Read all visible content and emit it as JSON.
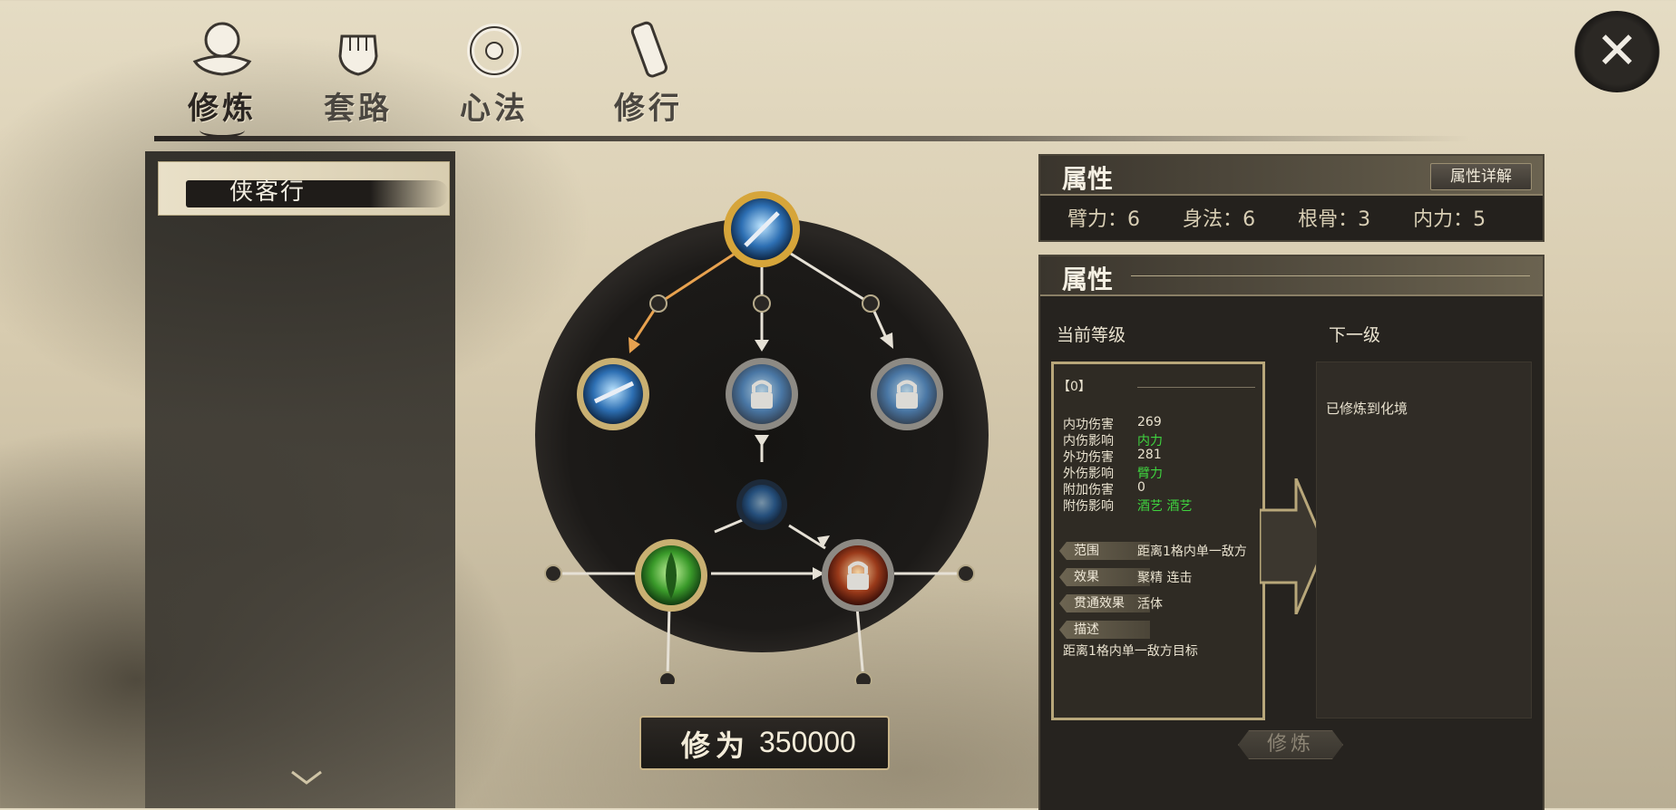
{
  "tabs": [
    {
      "label": "修炼",
      "icon": "cultivation-icon",
      "active": true
    },
    {
      "label": "套路",
      "icon": "fist-icon",
      "active": false
    },
    {
      "label": "心法",
      "icon": "swirl-icon",
      "active": false
    },
    {
      "label": "修行",
      "icon": "scroll-icon",
      "active": false
    }
  ],
  "sidebar": {
    "school_name": "侠客行"
  },
  "cultivation": {
    "label": "修为",
    "value": "350000"
  },
  "attributes": {
    "title": "属性",
    "detail_button": "属性详解",
    "stats": [
      {
        "name": "臂力",
        "value": "6"
      },
      {
        "name": "身法",
        "value": "6"
      },
      {
        "name": "根骨",
        "value": "3"
      },
      {
        "name": "内力",
        "value": "5"
      }
    ]
  },
  "level_panel": {
    "title": "属性",
    "current_label": "当前等级",
    "next_label": "下一级",
    "current_level": "【0】",
    "rows": [
      {
        "k": "内功伤害",
        "v": "269",
        "color": "#e9e2cf"
      },
      {
        "k": "内伤影响",
        "v": "内力",
        "color": "#3fd43f"
      },
      {
        "k": "外功伤害",
        "v": "281",
        "color": "#e9e2cf"
      },
      {
        "k": "外伤影响",
        "v": "臂力",
        "color": "#3fd43f"
      },
      {
        "k": "附加伤害",
        "v": "0",
        "color": "#e9e2cf"
      },
      {
        "k": "附伤影响",
        "v": "酒艺 酒艺",
        "color": "#3fd43f"
      }
    ],
    "range_label": "范围",
    "range_value": "距离1格内单一敌方",
    "effect_label": "效果",
    "effect_value": "聚精  连击",
    "pass_label": "贯通效果",
    "pass_value": "活体",
    "desc_label": "描述",
    "desc_value": "距离1格内单一敌方目标",
    "next_text": "已修炼到化境",
    "train_button": "修炼"
  }
}
